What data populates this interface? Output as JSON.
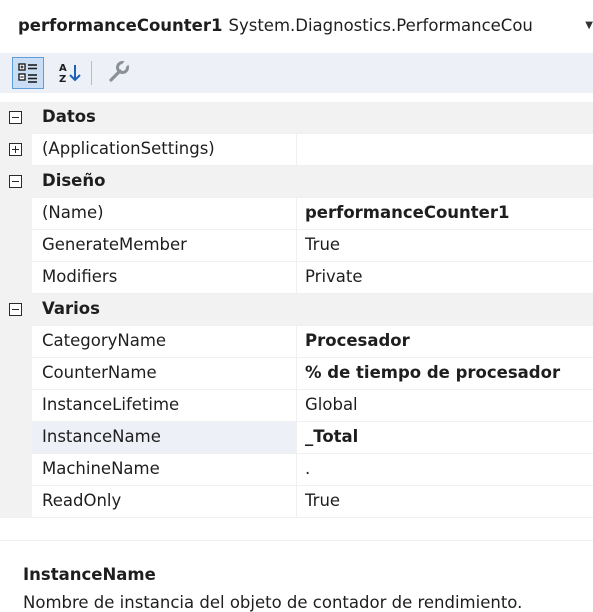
{
  "header": {
    "object_name": "performanceCounter1",
    "object_type": "System.Diagnostics.PerformanceCou"
  },
  "toolbar": {
    "categorized_icon": "categorized-icon",
    "alphabetical_icon": "alphabetical-sort-icon",
    "wrench_icon": "property-pages-icon"
  },
  "grid": {
    "categories": [
      {
        "label": "Datos",
        "state": "expanded"
      },
      {
        "label": "Diseño",
        "state": "expanded"
      },
      {
        "label": "Varios",
        "state": "expanded"
      }
    ],
    "app_settings": {
      "label": "(ApplicationSettings)",
      "value": ""
    },
    "design_props": [
      {
        "name": "(Name)",
        "value": "performanceCounter1"
      },
      {
        "name": "GenerateMember",
        "value": "True"
      },
      {
        "name": "Modifiers",
        "value": "Private"
      }
    ],
    "misc_props": [
      {
        "name": "CategoryName",
        "value": "Procesador"
      },
      {
        "name": "CounterName",
        "value": "% de tiempo de procesador"
      },
      {
        "name": "InstanceLifetime",
        "value": "Global"
      },
      {
        "name": "InstanceName",
        "value": "_Total"
      },
      {
        "name": "MachineName",
        "value": "."
      },
      {
        "name": "ReadOnly",
        "value": "True"
      }
    ]
  },
  "description": {
    "title": "InstanceName",
    "text": "Nombre de instancia del objeto de contador de rendimiento."
  },
  "colors": {
    "toolbar_bg": "#eef0f7",
    "category_bg": "#f2f2f2",
    "selected_bg": "#eef0f7",
    "active_button_bg": "#c9def5"
  }
}
